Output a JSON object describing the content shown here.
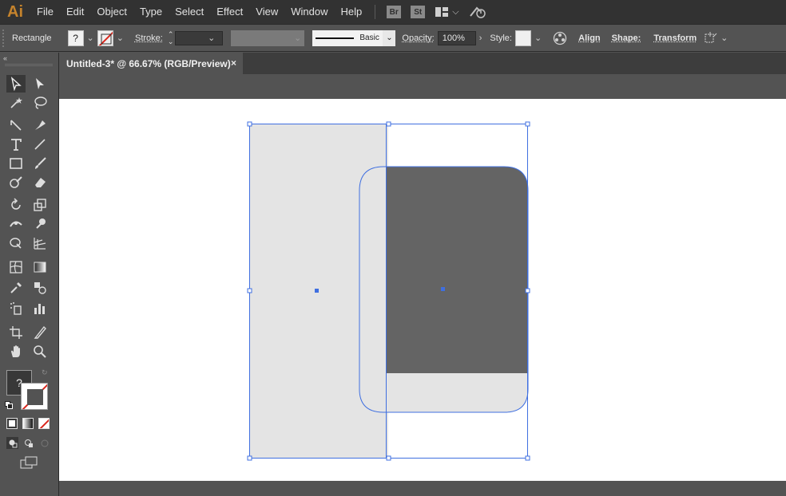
{
  "menubar": {
    "logo": "Ai",
    "items": [
      "File",
      "Edit",
      "Object",
      "Type",
      "Select",
      "Effect",
      "View",
      "Window",
      "Help"
    ],
    "badges": [
      "Br",
      "St"
    ]
  },
  "controlbar": {
    "tool_name": "Rectangle",
    "stroke_label": "Stroke:",
    "brush_label": "Basic",
    "opacity_label": "Opacity:",
    "opacity_value": "100%",
    "style_label": "Style:",
    "align_label": "Align",
    "shape_label": "Shape:",
    "transform_label": "Transform",
    "fill_swatch_text": "?"
  },
  "document": {
    "tab_title": "Untitled-3* @ 66.67% (RGB/Preview)",
    "close_glyph": "×"
  },
  "toolbar": {
    "fill_stroke_text": "?"
  },
  "colors": {
    "selection": "#3f6fe0",
    "light_fill": "#e4e4e4",
    "dark_fill": "#646464",
    "ui_dark": "#323232",
    "ui_mid": "#535353"
  }
}
